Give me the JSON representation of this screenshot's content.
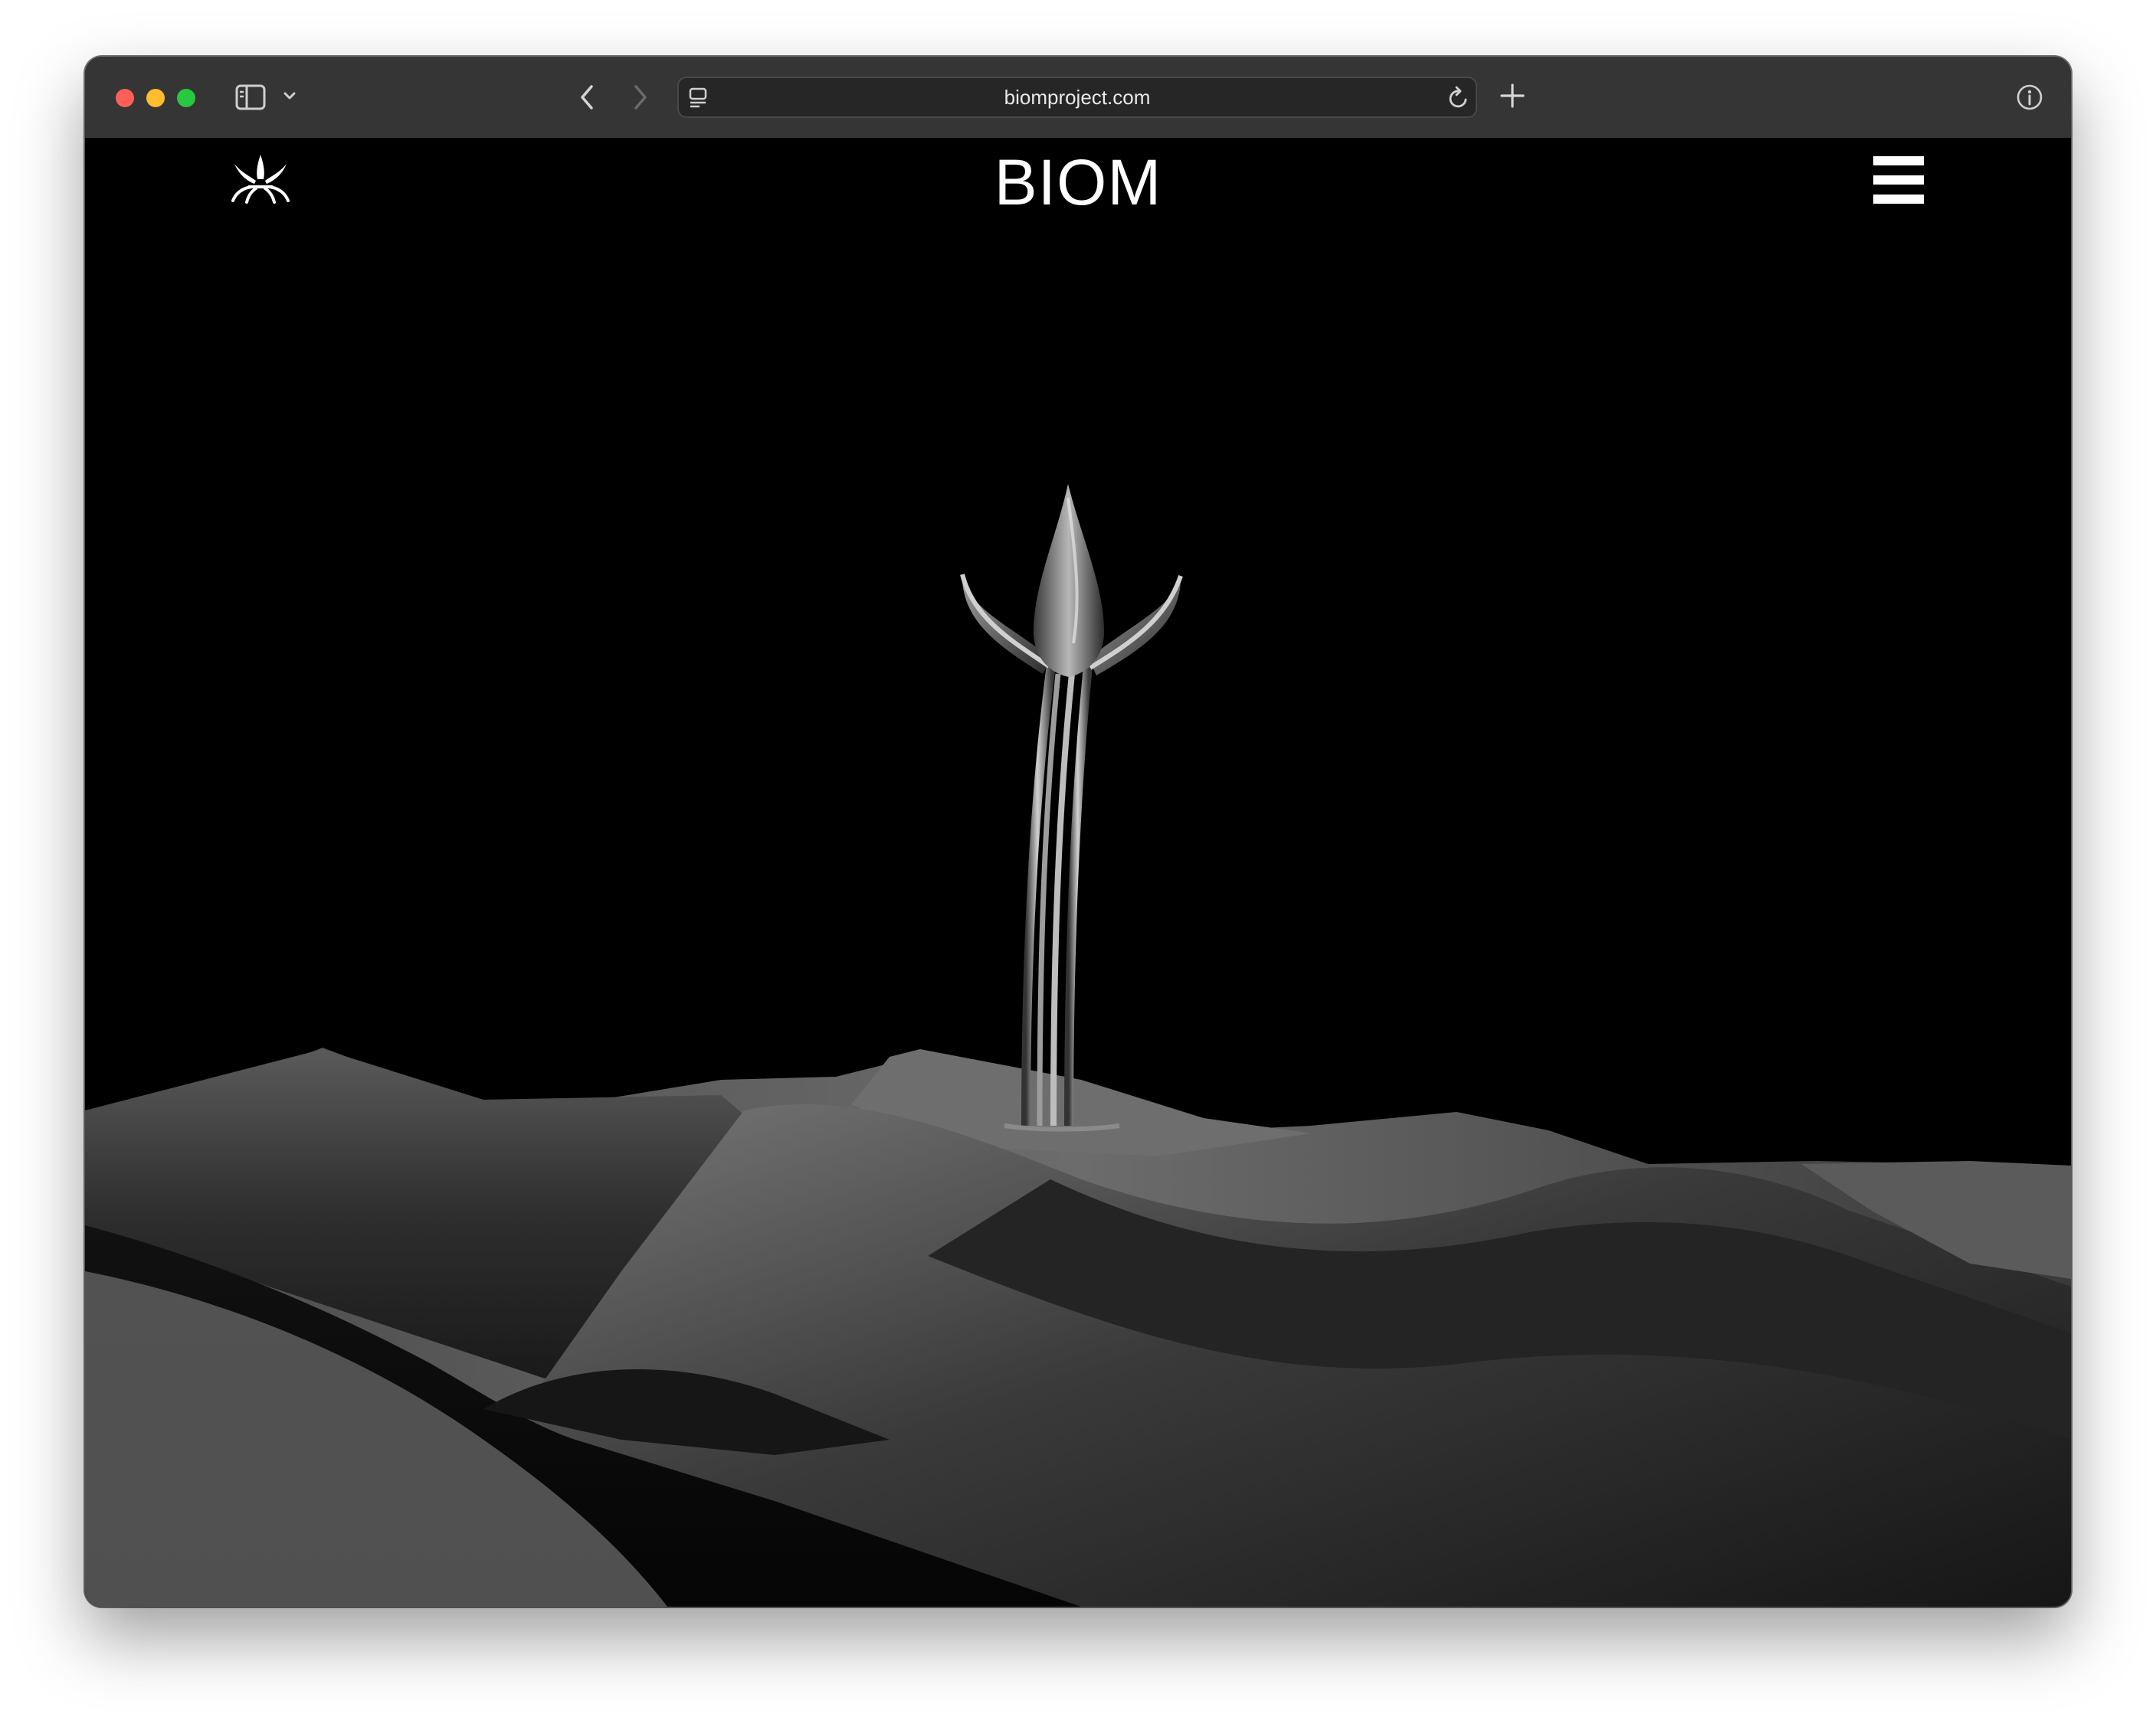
{
  "browser": {
    "url": "biomproject.com"
  },
  "site": {
    "brand": "BIOM"
  },
  "icons": {
    "logo": "biom-plant-logo-icon",
    "menu": "hamburger-menu-icon",
    "sidebar": "sidebar-icon",
    "back": "chevron-left-icon",
    "forward": "chevron-right-icon",
    "tab_overview": "tab-icon",
    "reload": "reload-icon",
    "new_tab": "plus-icon",
    "info": "info-icon"
  },
  "colors": {
    "background": "#000000",
    "toolbar": "#353535",
    "text": "#ffffff"
  }
}
